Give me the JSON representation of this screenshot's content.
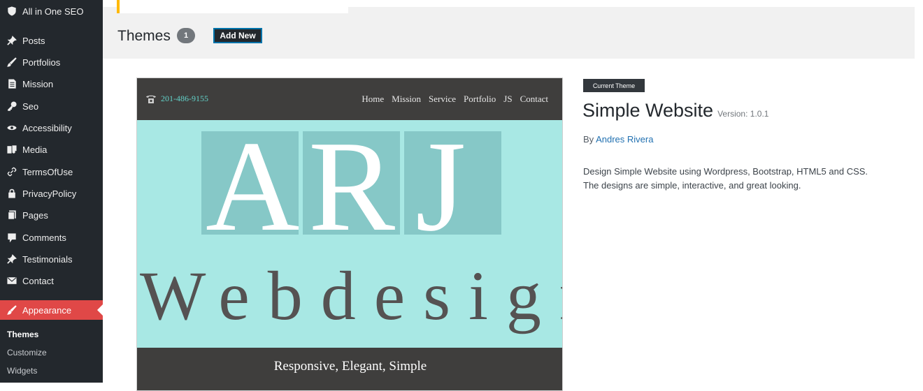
{
  "sidebar": {
    "items": [
      {
        "label": "All in One SEO",
        "icon": "shield-icon"
      },
      {
        "label": "Posts",
        "icon": "pin-icon"
      },
      {
        "label": "Portfolios",
        "icon": "brush-icon"
      },
      {
        "label": "Mission",
        "icon": "document-icon"
      },
      {
        "label": "Seo",
        "icon": "key-icon"
      },
      {
        "label": "Accessibility",
        "icon": "eye-icon"
      },
      {
        "label": "Media",
        "icon": "media-icon"
      },
      {
        "label": "TermsOfUse",
        "icon": "link-icon"
      },
      {
        "label": "PrivacyPolicy",
        "icon": "lock-icon"
      },
      {
        "label": "Pages",
        "icon": "pages-icon"
      },
      {
        "label": "Comments",
        "icon": "comment-icon"
      },
      {
        "label": "Testimonials",
        "icon": "pin-icon"
      },
      {
        "label": "Contact",
        "icon": "email-icon"
      },
      {
        "label": "Appearance",
        "icon": "paintbrush-icon",
        "active": true
      }
    ],
    "submenu": [
      {
        "label": "Themes",
        "current": true
      },
      {
        "label": "Customize"
      },
      {
        "label": "Widgets"
      }
    ],
    "active_color": "#e04847"
  },
  "header": {
    "title": "Themes",
    "count": "1",
    "add_new_label": "Add New"
  },
  "theme": {
    "badge": "Current Theme",
    "name": "Simple Website",
    "version": "Version: 1.0.1",
    "by": "By",
    "author": "Andres Rivera",
    "description": "Design Simple Website using Wordpress, Bootstrap, HTML5 and CSS. The designs are simple, interactive, and great looking."
  },
  "screenshot": {
    "phone": "201-486-9155",
    "nav_links": [
      "Home",
      "Mission",
      "Service",
      "Portfolio",
      "JS",
      "Contact"
    ],
    "letters": [
      "A",
      "R",
      "J"
    ],
    "word": "Webdesign",
    "tagline": "Responsive, Elegant, Simple",
    "colors": {
      "nav": "#3f3e3d",
      "hero": "#a8e8e4",
      "letter_box": "#86c8c7",
      "phone": "#62d1c8"
    }
  }
}
